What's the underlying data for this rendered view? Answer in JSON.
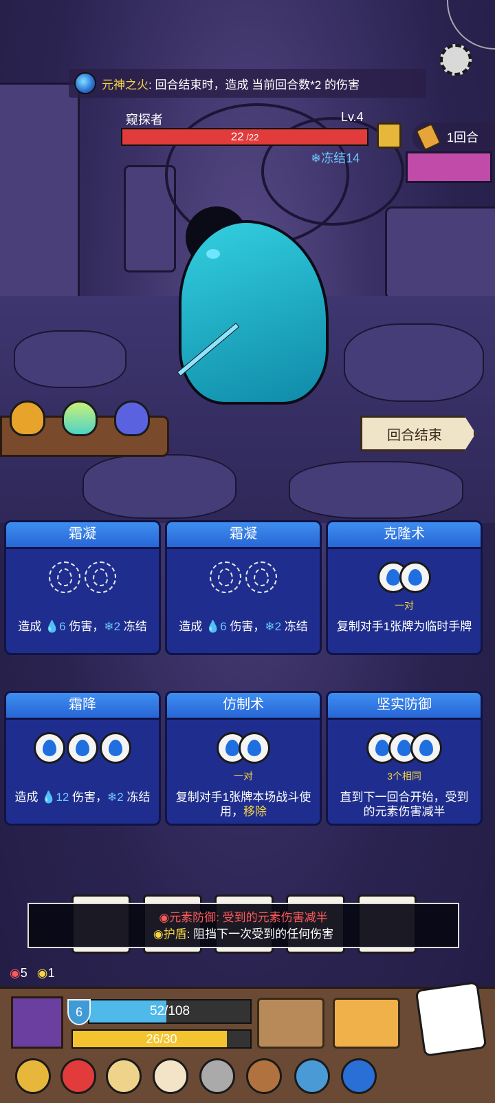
{
  "banner": {
    "key": "元神之火",
    "text": ": 回合结束时，造成 当前回合数*2 的伤害"
  },
  "enemy": {
    "name": "窥探者",
    "level": "Lv.4",
    "hp": "22",
    "hp_max": " /22",
    "hp_fraction": 1.0,
    "status": "冻结14"
  },
  "round": {
    "label": "1回合"
  },
  "end_turn": "回合结束",
  "cards": [
    {
      "title": "霜凝",
      "sub": "",
      "pre": "造成 ",
      "n1": "6",
      "mid": " 伤害，",
      "n2": "2",
      "post": " 冻结"
    },
    {
      "title": "霜凝",
      "sub": "",
      "pre": "造成 ",
      "n1": "6",
      "mid": " 伤害，",
      "n2": "2",
      "post": " 冻结"
    },
    {
      "title": "克隆术",
      "sub": "一对",
      "text": "复制对手1张牌为临时手牌"
    },
    {
      "title": "霜降",
      "sub": "",
      "pre": "造成 ",
      "n1": "12",
      "mid": " 伤害，",
      "n2": "2",
      "post": " 冻结"
    },
    {
      "title": "仿制术",
      "sub": "一对",
      "text": "复制对手1张牌本场战斗使用，",
      "remove": "移除"
    },
    {
      "title": "坚实防御",
      "sub": "3个相同",
      "text": "直到下一回合开始，受到的元素伤害减半"
    }
  ],
  "status_panel": {
    "line1_key": "元素防御",
    "line1_text": ": 受到的元素伤害减半",
    "line2_key": "护盾",
    "line2_text": ": 阻挡下一次受到的任何伤害"
  },
  "mini_stats": {
    "elemental_defense": "5",
    "shield": "1"
  },
  "player": {
    "shield": "6",
    "hp": "52/108",
    "hp_fraction": 0.48,
    "energy": "26/30",
    "energy_fraction": 0.87
  },
  "colors": {
    "card_blue": "#1f2e8e",
    "card_header": "#2766d6",
    "hp_red": "#e23b3b",
    "gold": "#f6d743"
  }
}
